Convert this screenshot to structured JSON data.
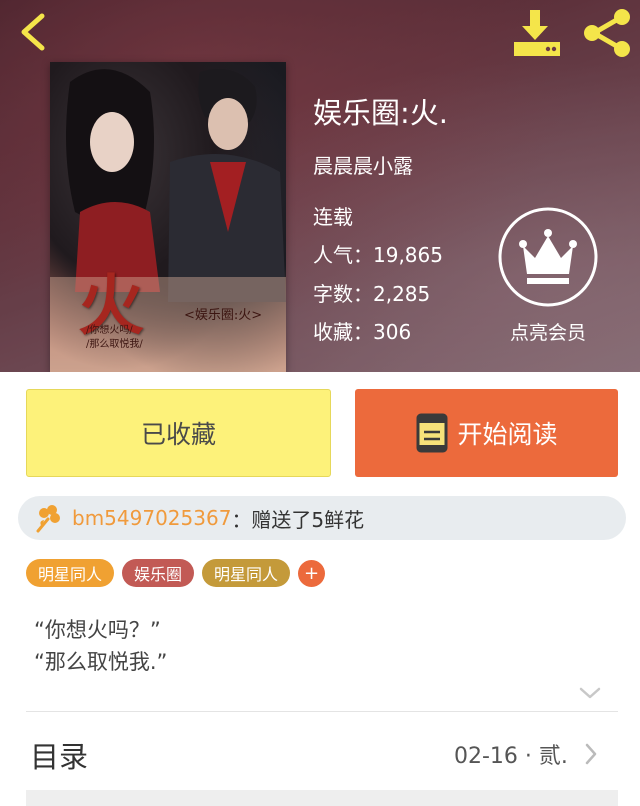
{
  "header": {
    "back_icon": "chevron-left-icon",
    "download_icon": "download-icon",
    "share_icon": "share-icon"
  },
  "book": {
    "title": "娱乐圈:火.",
    "author": "晨晨晨小露",
    "status": "连载",
    "popularity_label": "人气：",
    "popularity": "19,865",
    "words_label": "字数：",
    "words": "2,285",
    "favorites_label": "收藏：",
    "favorites": "306",
    "cover": {
      "big_char": "火",
      "sub": "<娱乐圈:火>",
      "lines": [
        "/你想火吗/",
        "/那么取悦我/"
      ]
    }
  },
  "vip": {
    "label": "点亮会员",
    "icon": "crown-icon"
  },
  "actions": {
    "collected_label": "已收藏",
    "read_label": "开始阅读",
    "read_icon": "book-icon"
  },
  "gift": {
    "icon": "flower-icon",
    "user": "bm5497025367",
    "text": "：赠送了5鲜花"
  },
  "tags": [
    {
      "label": "明星同人",
      "color": "#f0a132"
    },
    {
      "label": "娱乐圈",
      "color": "#c25a55"
    },
    {
      "label": "明星同人",
      "color": "#c49a3a"
    }
  ],
  "tag_add_label": "+",
  "synopsis": {
    "line1": "“你想火吗？”",
    "line2": "“那么取悦我.”"
  },
  "toc": {
    "label": "目录",
    "latest": "02-16 · 贰."
  },
  "colors": {
    "collected_bg": "#fdf27a",
    "read_bg": "#ec6a3c",
    "gift_user": "#f09a3c",
    "header_icon": "#f4e54a"
  }
}
